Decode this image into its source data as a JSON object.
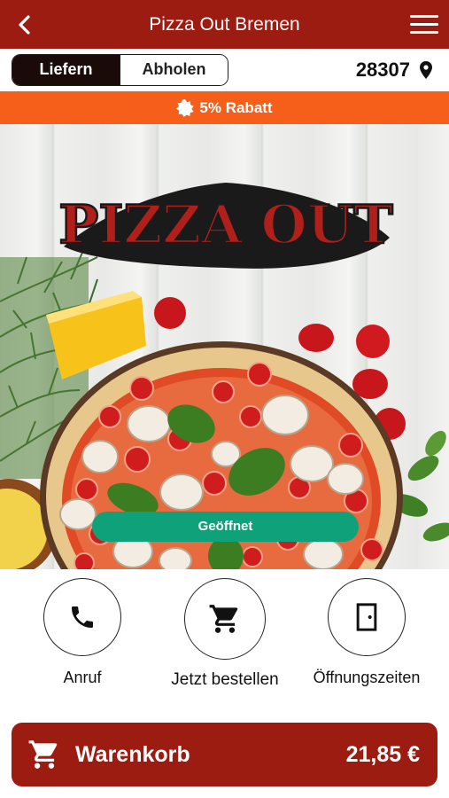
{
  "header": {
    "title": "Pizza Out Bremen"
  },
  "mode": {
    "deliver_label": "Liefern",
    "pickup_label": "Abholen",
    "active": "deliver"
  },
  "location": {
    "zip": "28307"
  },
  "promo": {
    "text": "5% Rabatt"
  },
  "hero": {
    "logo_text": "PIZZA OUT",
    "status_label": "Geöffnet"
  },
  "actions": [
    {
      "label": "Anruf",
      "icon": "phone-icon"
    },
    {
      "label": "Jetzt bestellen",
      "icon": "cart-icon"
    },
    {
      "label": "Öffnungszeiten",
      "icon": "door-icon"
    }
  ],
  "cart": {
    "label": "Warenkorb",
    "total": "21,85 €"
  },
  "colors": {
    "brand": "#9c1c12",
    "promo": "#f55f1a",
    "open": "#0fa17a"
  }
}
